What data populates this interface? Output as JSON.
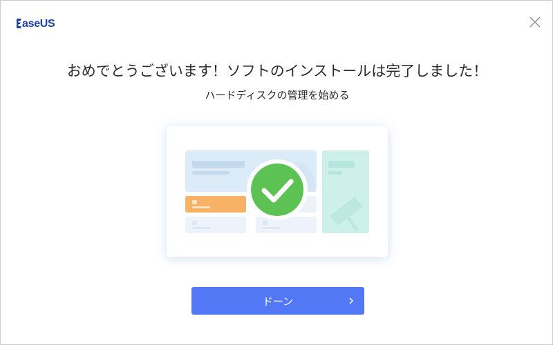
{
  "app": {
    "logo_text": "aseUS"
  },
  "icons": {
    "close": "close-icon",
    "check": "checkmark-icon",
    "arrow": "chevron-right-icon",
    "logo": "easeus-logo-icon"
  },
  "main": {
    "title": "おめでとうございます！ソフトのインストールは完了しました！",
    "subtitle": "ハードディスクの管理を始める"
  },
  "actions": {
    "done_label": "ドーン"
  },
  "colors": {
    "accent": "#5278f6",
    "brand": "#1d3fae",
    "success": "#5cc254"
  }
}
